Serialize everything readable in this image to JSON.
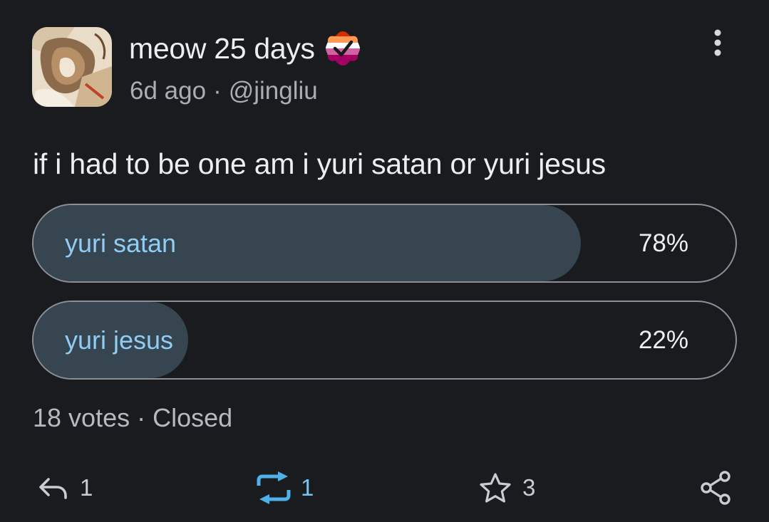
{
  "post": {
    "display_name": "meow 25 days",
    "display_name_emoji": "lesbian-flag-checkmark-emoji",
    "time_ago": "6d ago",
    "meta_separator": "·",
    "handle": "@jingliu",
    "text": "if i had to be one am i yuri satan or yuri jesus"
  },
  "poll": {
    "options": [
      {
        "label": "yuri satan",
        "percent_label": "78%",
        "percent": 78
      },
      {
        "label": "yuri jesus",
        "percent_label": "22%",
        "percent": 22
      }
    ],
    "votes": "18 votes",
    "separator": "·",
    "status": "Closed"
  },
  "actions": {
    "reply": {
      "icon": "reply-icon",
      "count": "1"
    },
    "boost": {
      "icon": "boost-icon",
      "count": "1",
      "active": true
    },
    "favourite": {
      "icon": "star-icon",
      "count": "3"
    },
    "share": {
      "icon": "share-icon"
    }
  },
  "menu": {
    "icon": "more-vertical-icon"
  },
  "colors": {
    "background": "#191b1f",
    "poll_fill": "#36454f",
    "poll_border": "#8c8f96",
    "accent": "#8fcdf4",
    "boost_active": "#4fb1ea",
    "text_primary": "#eceef2",
    "text_secondary": "#a9adb5"
  }
}
